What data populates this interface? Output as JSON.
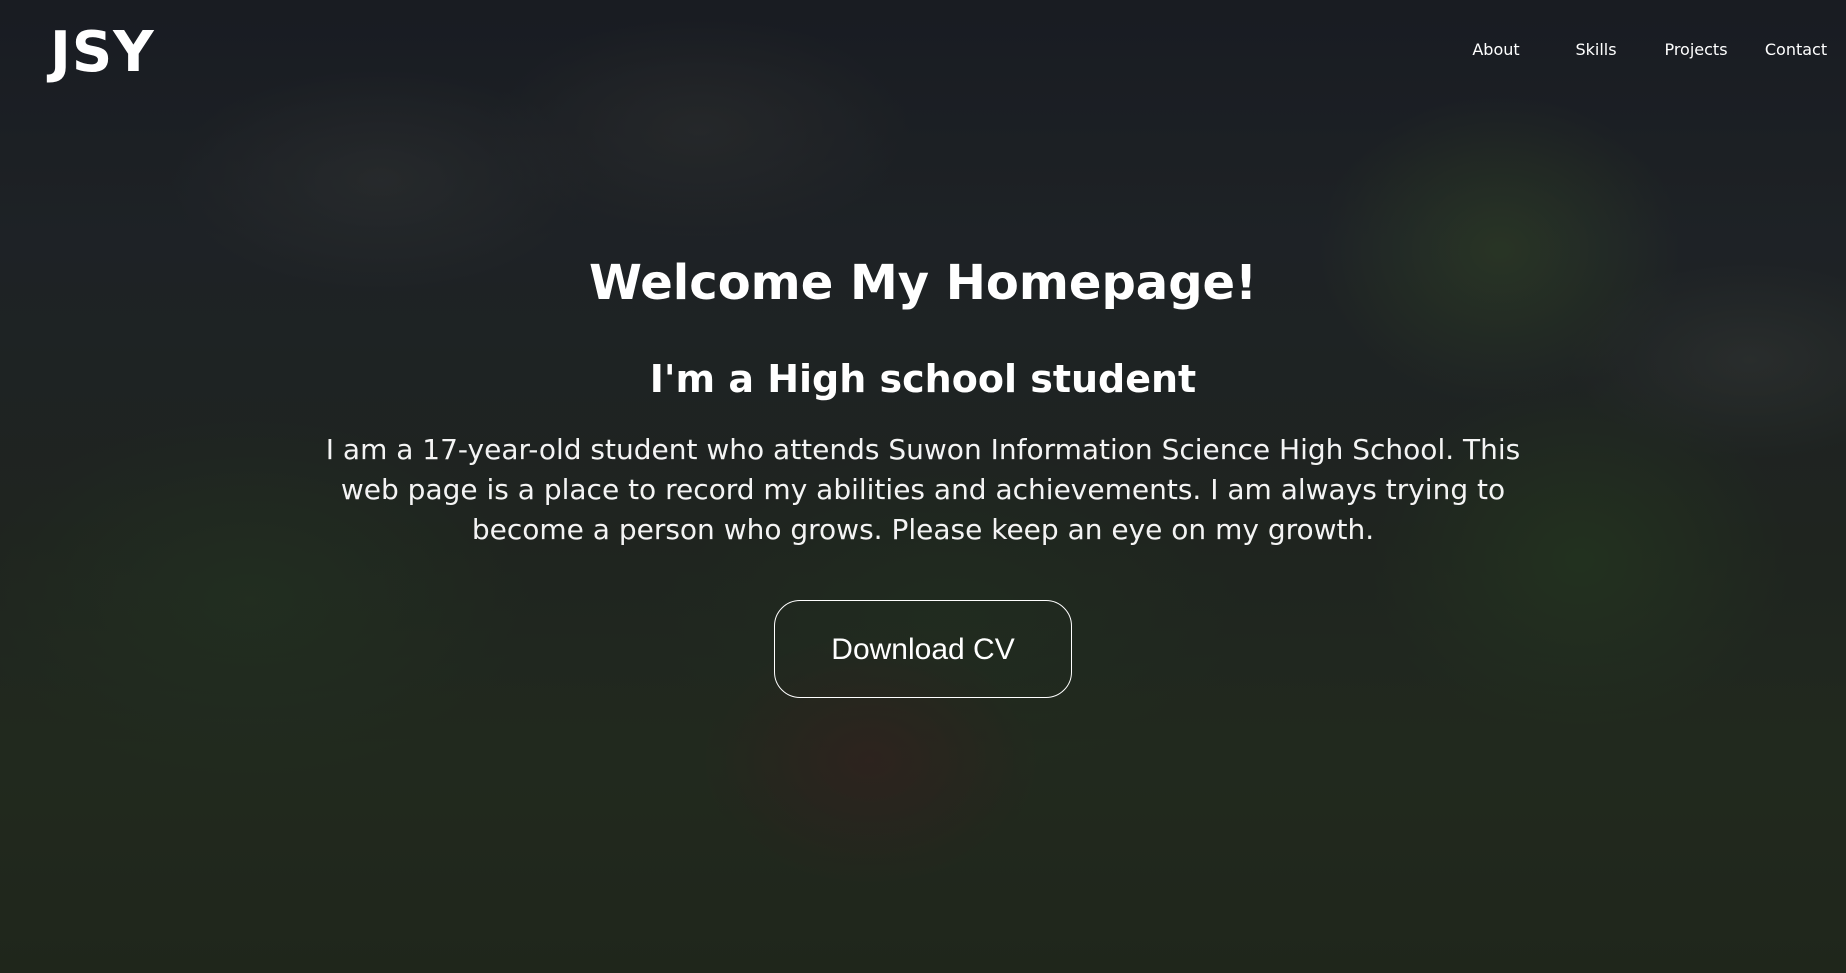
{
  "header": {
    "logo": "JSY",
    "nav": [
      {
        "label": "About"
      },
      {
        "label": "Skills"
      },
      {
        "label": "Projects"
      },
      {
        "label": "Contact"
      }
    ]
  },
  "hero": {
    "title": "Welcome My Homepage!",
    "subtitle": "I'm a High school student",
    "description": "I am a 17-year-old student who attends Suwon Information Science High School. This web page is a place to record my abilities and achievements. I am always trying to become a person who grows. Please keep an eye on my growth.",
    "button_label": "Download CV"
  }
}
